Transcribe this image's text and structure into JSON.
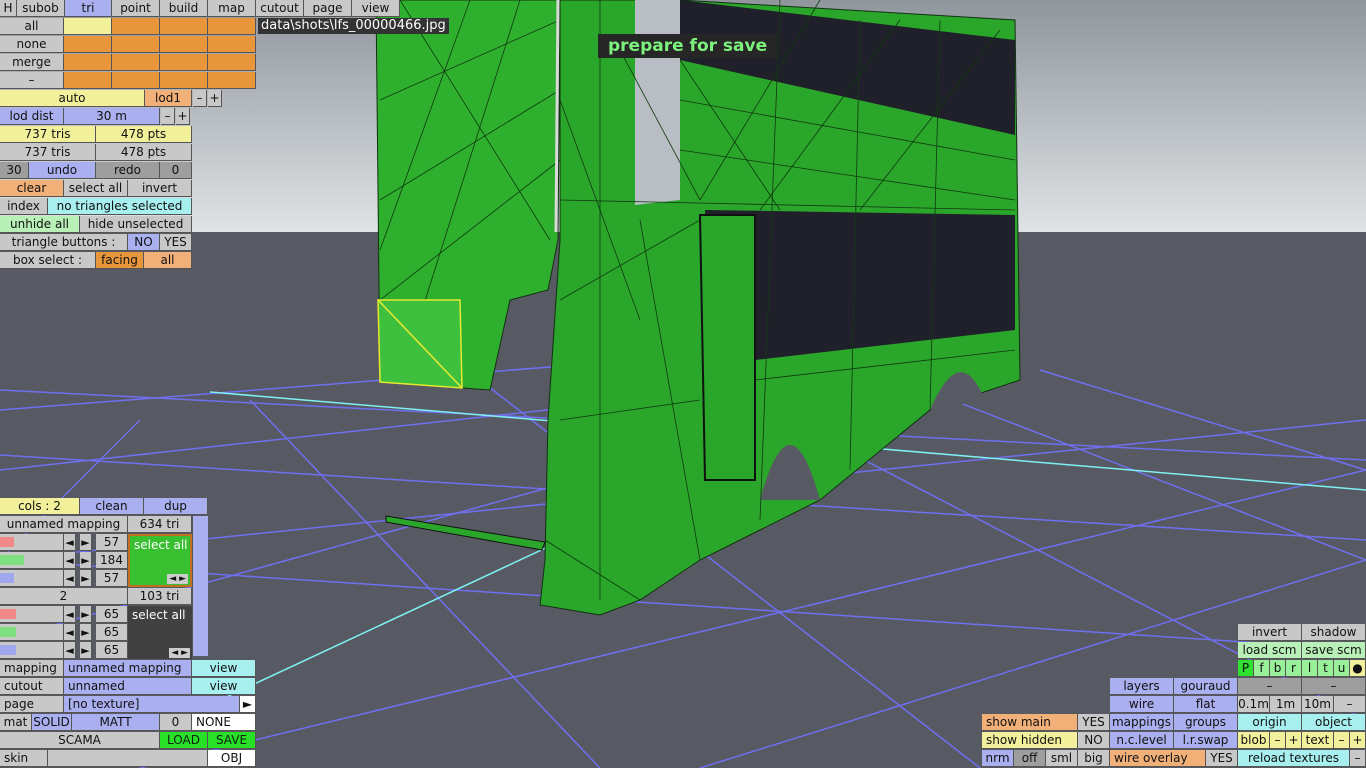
{
  "file_path": "data\\shots\\lfs_00000466.jpg",
  "status_message": "prepare for save",
  "top_menu": [
    "H",
    "subob",
    "tri",
    "point",
    "build",
    "map",
    "cutout",
    "page",
    "view"
  ],
  "select_rows": [
    "all",
    "none",
    "merge",
    "–"
  ],
  "lod": {
    "mode": "auto",
    "level": "lod1",
    "minus": "–",
    "plus": "+",
    "dist_label": "lod dist",
    "dist_value": "30 m"
  },
  "counts": [
    {
      "tris": "737 tris",
      "pts": "478 pts"
    },
    {
      "tris": "737 tris",
      "pts": "478 pts"
    }
  ],
  "undo_row": {
    "count": "30",
    "undo": "undo",
    "redo": "redo",
    "redo_count": "0"
  },
  "clear_row": {
    "clear": "clear",
    "select_all": "select all",
    "invert": "invert"
  },
  "index_row": {
    "index": "index",
    "info": "no triangles selected"
  },
  "hide_row": {
    "unhide": "unhide all",
    "hide": "hide unselected"
  },
  "tri_buttons": {
    "label": "triangle buttons :",
    "no": "NO",
    "yes": "YES"
  },
  "box_select": {
    "label": "box select :",
    "facing": "facing",
    "all": "all"
  },
  "cols_row": {
    "cols": "cols : 2",
    "clean": "clean",
    "dup": "dup"
  },
  "mapping1": {
    "name": "unnamed mapping",
    "tris": "634 tri",
    "values": [
      "57",
      "184",
      "57"
    ],
    "select_all": "select all",
    "fills": [
      0.22,
      0.38,
      0.22
    ],
    "color": "#38c030"
  },
  "mapping2": {
    "name": "2",
    "tris": "103 tri",
    "values": [
      "65",
      "65",
      "65"
    ],
    "select_all": "select all",
    "fills": [
      0.25,
      0.25,
      0.25
    ],
    "color": "#414141"
  },
  "mapping_row": {
    "label": "mapping",
    "value": "unnamed mapping",
    "view": "view"
  },
  "cutout_row": {
    "label": "cutout",
    "value": "unnamed",
    "view": "view"
  },
  "page_row": {
    "label": "page",
    "value": "[no texture]",
    "arrow": "►"
  },
  "mat_row": {
    "mat": "mat",
    "solid": "SOLID",
    "matt": "MATT",
    "num": "0",
    "none": "NONE"
  },
  "scama_row": {
    "scama": "SCAMA",
    "load": "LOAD",
    "save": "SAVE"
  },
  "skin_row": {
    "skin": "skin",
    "obj": "OBJ"
  },
  "right_panel": {
    "invert": "invert",
    "shadow": "shadow",
    "load_scm": "load scm",
    "save_scm": "save scm",
    "flags": [
      "P",
      "f",
      "b",
      "r",
      "l",
      "t",
      "u",
      "●"
    ],
    "layers": "layers",
    "gouraud": "gouraud",
    "dash": "–",
    "wire": "wire",
    "flat": "flat",
    "sizes": [
      "0.1m",
      "1m",
      "10m",
      "–"
    ],
    "show_main": "show main",
    "show_main_val": "YES",
    "mappings": "mappings",
    "groups": "groups",
    "origin": "origin",
    "object": "object",
    "show_hidden": "show hidden",
    "show_hidden_val": "NO",
    "nc_level": "n.c.level",
    "lr_swap": "l.r.swap",
    "blob": "blob",
    "text": "text",
    "minus": "–",
    "plus": "+",
    "nrm": "nrm",
    "off": "off",
    "sml": "sml",
    "big": "big",
    "wire_overlay": "wire overlay",
    "wire_overlay_val": "YES",
    "reload": "reload textures"
  }
}
